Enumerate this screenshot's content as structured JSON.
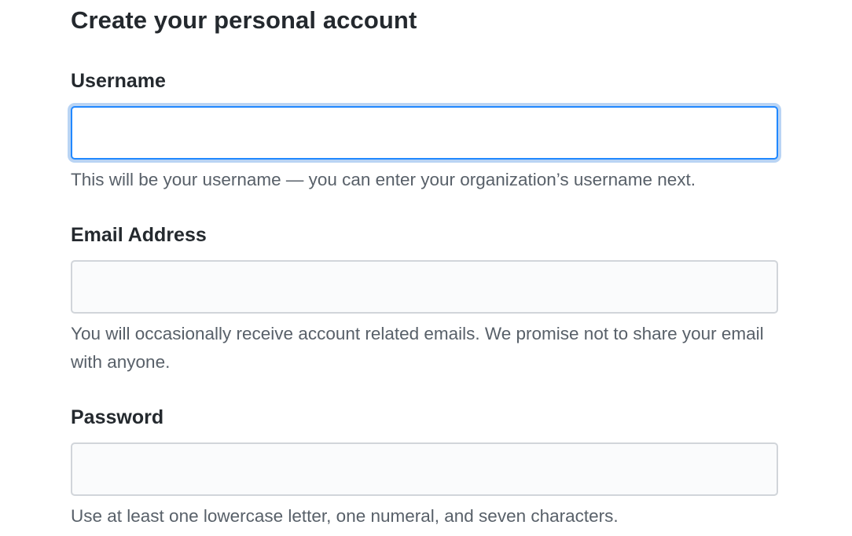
{
  "form": {
    "title": "Create your personal account",
    "fields": [
      {
        "label": "Username",
        "value": "",
        "placeholder": "",
        "note": "This will be your username — you can enter your organization’s username next.",
        "focused": true
      },
      {
        "label": "Email Address",
        "value": "",
        "placeholder": "",
        "note": "You will occasionally receive account related emails. We promise not to share your email with anyone.",
        "focused": false
      },
      {
        "label": "Password",
        "value": "",
        "placeholder": "",
        "note": "Use at least one lowercase letter, one numeral, and seven characters.",
        "focused": false
      }
    ]
  },
  "colors": {
    "text": "#24292e",
    "muted_text": "#586069",
    "input_border": "#d1d5da",
    "input_background": "#fafbfc",
    "focus_border": "#2188ff"
  },
  "icons": []
}
